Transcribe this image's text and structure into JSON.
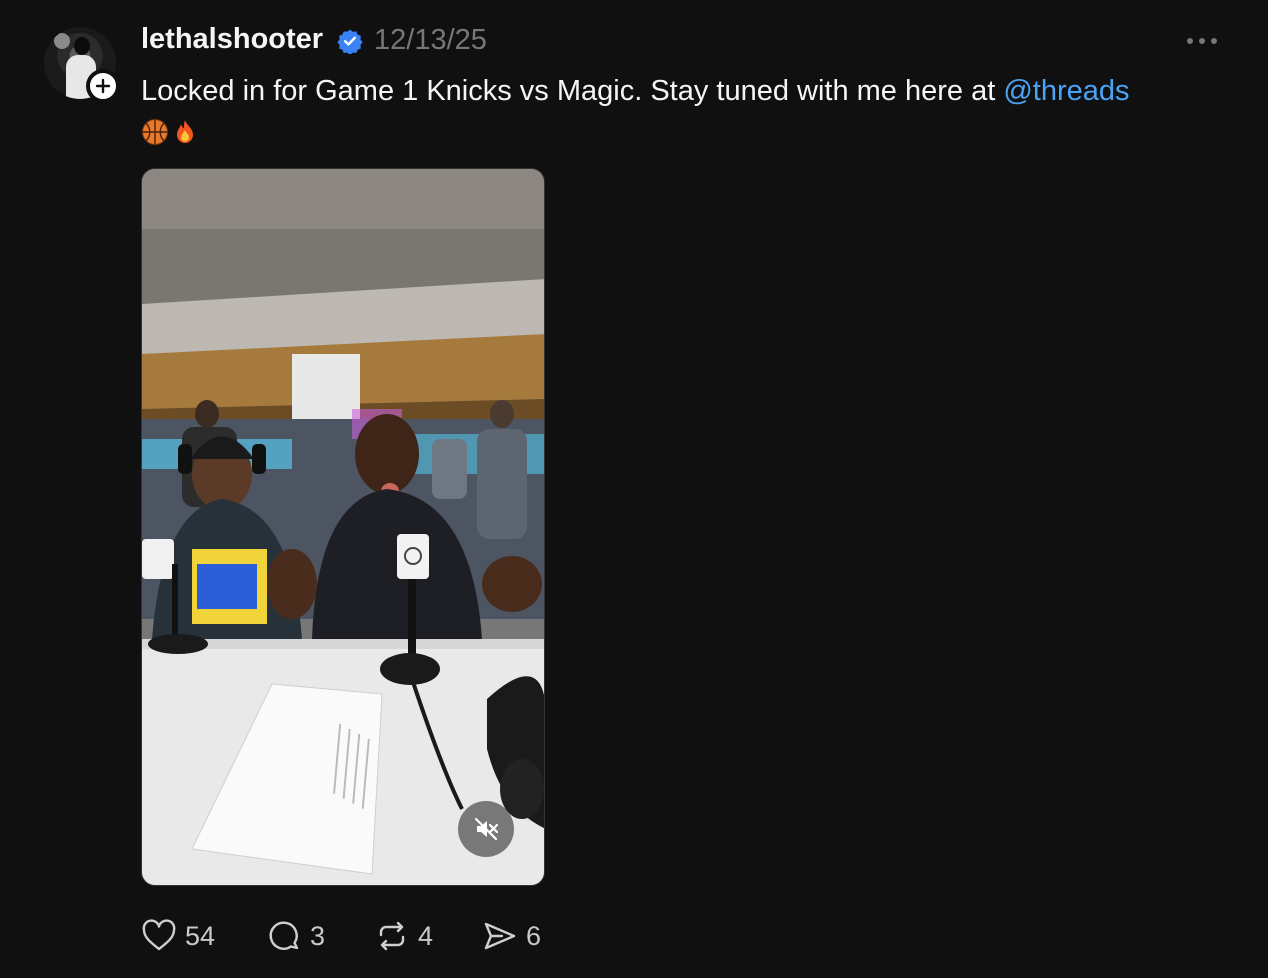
{
  "post": {
    "username": "lethalshooter",
    "timestamp": "12/13/25",
    "text_before": "Locked in for Game 1 Knicks vs Magic. Stay tuned with me here at ",
    "mention": "@threads",
    "emojis": [
      "basketball-emoji",
      "fire-emoji"
    ],
    "verified": true
  },
  "media": {
    "type": "video",
    "muted": true
  },
  "actions": {
    "likes": "54",
    "replies": "3",
    "reposts": "4",
    "shares": "6"
  },
  "colors": {
    "background": "#101010",
    "text": "#f3f5f7",
    "muted_text": "#777777",
    "mention": "#4aa3f5",
    "verified": "#3b82f6"
  },
  "icons": {
    "verified": "verified-badge-icon",
    "more": "more-dots-icon",
    "follow": "plus-icon",
    "like": "heart-icon",
    "reply": "comment-icon",
    "repost": "repost-icon",
    "share": "send-icon",
    "mute": "speaker-muted-icon"
  }
}
